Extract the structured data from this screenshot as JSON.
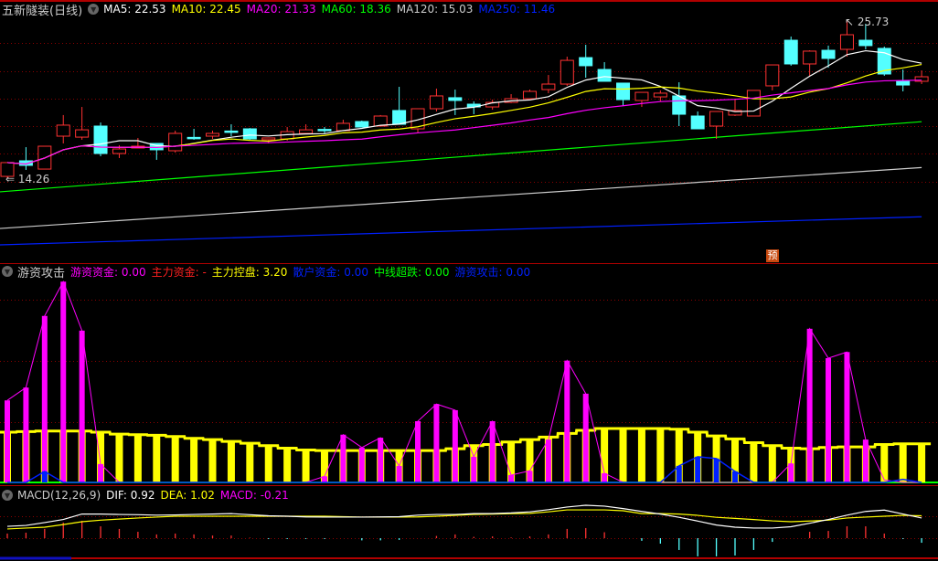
{
  "main_panel": {
    "title": "五新隧装(日线)",
    "ma_legend": [
      {
        "label": "MA5: 22.53",
        "color": "#ffffff"
      },
      {
        "label": "MA10: 22.45",
        "color": "#ffff00"
      },
      {
        "label": "MA20: 21.33",
        "color": "#ff00ff"
      },
      {
        "label": "MA60: 18.36",
        "color": "#00ff00"
      },
      {
        "label": "MA120: 15.03",
        "color": "#cccccc"
      },
      {
        "label": "MA250: 11.46",
        "color": "#0020ff"
      }
    ],
    "high_label": "25.73",
    "low_label": "14.26",
    "forecast_badge": "预"
  },
  "indicator_panel": {
    "title": "游资攻击",
    "legend": [
      {
        "label": "游资资金: 0.00",
        "color": "#ff00ff"
      },
      {
        "label": "主力资金: -",
        "color": "#ff2020"
      },
      {
        "label": "主力控盘: 3.20",
        "color": "#ffff00"
      },
      {
        "label": "散户资金: 0.00",
        "color": "#0020ff"
      },
      {
        "label": "中线超跌: 0.00",
        "color": "#00ff00"
      },
      {
        "label": "游资攻击: 0.00",
        "color": "#0020ff"
      }
    ]
  },
  "macd_panel": {
    "title": "MACD(12,26,9)",
    "legend": [
      {
        "label": "DIF: 0.92",
        "color": "#ffffff"
      },
      {
        "label": "DEA: 1.02",
        "color": "#ffff00"
      },
      {
        "label": "MACD: -0.21",
        "color": "#ff00ff"
      }
    ]
  },
  "colors": {
    "up": "#ff3232",
    "down": "#54ffff",
    "grid": "#8b0000",
    "separator": "#b00000"
  },
  "chart_data": [
    {
      "type": "candlestick",
      "title": "五新隧装(日线)",
      "price_range": [
        8.29,
        27.19
      ],
      "candles": [
        [
          14.39,
          15.39,
          14.26,
          15.39
        ],
        [
          15.52,
          16.51,
          14.86,
          15.19
        ],
        [
          14.92,
          16.58,
          14.92,
          16.58
        ],
        [
          17.31,
          18.84,
          16.78,
          18.11
        ],
        [
          17.24,
          19.43,
          17.05,
          17.77
        ],
        [
          18.04,
          18.3,
          15.85,
          16.05
        ],
        [
          16.05,
          16.65,
          15.72,
          16.38
        ],
        [
          16.45,
          17.18,
          16.45,
          16.58
        ],
        [
          16.78,
          16.78,
          15.59,
          16.32
        ],
        [
          16.25,
          17.71,
          16.12,
          17.51
        ],
        [
          17.22,
          17.84,
          17.05,
          17.18
        ],
        [
          17.31,
          17.71,
          17.11,
          17.51
        ],
        [
          17.68,
          18.17,
          17.31,
          17.64
        ],
        [
          17.84,
          17.9,
          17.05,
          17.11
        ],
        [
          17.05,
          17.18,
          16.78,
          17.18
        ],
        [
          17.11,
          17.97,
          16.98,
          17.64
        ],
        [
          17.51,
          18.17,
          17.51,
          17.77
        ],
        [
          17.8,
          17.97,
          17.51,
          17.75
        ],
        [
          17.71,
          18.5,
          17.71,
          18.24
        ],
        [
          18.37,
          18.44,
          17.97,
          17.97
        ],
        [
          18.04,
          18.84,
          18.04,
          18.77
        ],
        [
          19.17,
          20.89,
          18.17,
          18.17
        ],
        [
          17.84,
          19.3,
          17.58,
          19.3
        ],
        [
          19.3,
          20.76,
          19.1,
          20.23
        ],
        [
          20.1,
          20.69,
          18.84,
          19.9
        ],
        [
          19.63,
          19.83,
          18.9,
          19.43
        ],
        [
          19.43,
          19.96,
          19.23,
          19.76
        ],
        [
          19.76,
          20.36,
          19.7,
          20.03
        ],
        [
          20.03,
          20.69,
          20.03,
          20.56
        ],
        [
          20.69,
          21.75,
          20.43,
          21.09
        ],
        [
          21.09,
          23.08,
          20.96,
          22.81
        ],
        [
          23.01,
          23.94,
          21.55,
          22.42
        ],
        [
          22.15,
          22.68,
          21.29,
          21.29
        ],
        [
          21.16,
          21.16,
          19.5,
          19.96
        ],
        [
          19.9,
          20.49,
          19.43,
          20.49
        ],
        [
          20.16,
          20.63,
          19.83,
          20.43
        ],
        [
          20.23,
          21.22,
          18.04,
          18.9
        ],
        [
          18.77,
          19.1,
          17.84,
          17.84
        ],
        [
          18.04,
          19.1,
          17.11,
          19.1
        ],
        [
          18.84,
          20.03,
          18.77,
          19.17
        ],
        [
          18.77,
          20.63,
          18.77,
          20.63
        ],
        [
          20.96,
          22.48,
          20.63,
          22.48
        ],
        [
          24.27,
          24.54,
          22.42,
          22.55
        ],
        [
          22.55,
          23.54,
          21.69,
          23.48
        ],
        [
          23.54,
          23.88,
          22.28,
          22.95
        ],
        [
          23.61,
          25.73,
          23.08,
          24.67
        ],
        [
          24.27,
          25.47,
          23.61,
          23.88
        ],
        [
          23.68,
          23.81,
          21.69,
          21.82
        ],
        [
          21.29,
          22.15,
          20.56,
          21.02
        ],
        [
          21.29,
          22.08,
          21.09,
          21.62
        ]
      ],
      "candle_fields": [
        "open",
        "high",
        "low",
        "close"
      ],
      "long_ma": {
        "ma60": [
          13.27,
          18.36
        ],
        "ma120": [
          10.61,
          15.03
        ],
        "ma250": [
          9.42,
          11.46
        ]
      }
    },
    {
      "type": "bar",
      "title": "游资攻击",
      "ylim": [
        0,
        3.55
      ],
      "magenta": [
        1.34,
        1.55,
        2.72,
        3.28,
        2.48,
        0.3,
        0,
        0,
        0,
        0,
        0,
        0,
        0,
        0,
        0,
        0,
        0,
        0.1,
        0.78,
        0.57,
        0.73,
        0.27,
        1.0,
        1.28,
        1.18,
        0.42,
        1.0,
        0.12,
        0.19,
        0.7,
        1.99,
        1.45,
        0.15,
        0,
        0,
        0,
        0,
        0,
        0,
        0,
        0,
        0,
        0.31,
        2.51,
        2.03,
        2.13,
        0.7,
        0.04,
        0,
        0
      ],
      "yellow": [
        0.82,
        0.83,
        0.84,
        0.84,
        0.84,
        0.82,
        0.79,
        0.78,
        0.77,
        0.75,
        0.72,
        0.7,
        0.67,
        0.64,
        0.6,
        0.56,
        0.53,
        0.52,
        0.52,
        0.52,
        0.52,
        0.52,
        0.52,
        0.52,
        0.55,
        0.6,
        0.62,
        0.66,
        0.7,
        0.74,
        0.8,
        0.85,
        0.88,
        0.88,
        0.88,
        0.88,
        0.87,
        0.82,
        0.76,
        0.71,
        0.65,
        0.6,
        0.56,
        0.55,
        0.57,
        0.58,
        0.58,
        0.62,
        0.63,
        0.63
      ],
      "blue": [
        0,
        0,
        0.18,
        0,
        0,
        0,
        0,
        0,
        0,
        0,
        0,
        0,
        0,
        0,
        0,
        0,
        0,
        0,
        0,
        0,
        0,
        0,
        0,
        0,
        0,
        0,
        0,
        0,
        0,
        0,
        0,
        0,
        0,
        0,
        0,
        0,
        0.27,
        0.42,
        0.39,
        0.18,
        0,
        0,
        0,
        0,
        0,
        0,
        0,
        0,
        0.05,
        0
      ]
    },
    {
      "type": "line",
      "title": "MACD(12,26,9)",
      "ylim": [
        -1.05,
        2.3
      ],
      "dif": [
        0.54,
        0.58,
        0.71,
        0.85,
        1.1,
        1.1,
        1.08,
        1.07,
        1.05,
        1.06,
        1.08,
        1.1,
        1.12,
        1.07,
        1.02,
        1.0,
        0.97,
        0.96,
        0.96,
        0.96,
        0.97,
        0.98,
        1.05,
        1.08,
        1.08,
        1.12,
        1.12,
        1.15,
        1.2,
        1.3,
        1.42,
        1.5,
        1.46,
        1.35,
        1.22,
        1.1,
        0.95,
        0.78,
        0.6,
        0.5,
        0.46,
        0.46,
        0.52,
        0.68,
        0.85,
        1.05,
        1.22,
        1.28,
        1.1,
        0.92
      ],
      "dea": [
        0.42,
        0.46,
        0.5,
        0.62,
        0.75,
        0.82,
        0.87,
        0.92,
        0.96,
        1.0,
        1.0,
        1.0,
        1.0,
        1.0,
        1.0,
        1.0,
        1.0,
        1.0,
        0.98,
        0.96,
        0.96,
        0.96,
        0.97,
        1.0,
        1.04,
        1.08,
        1.1,
        1.12,
        1.13,
        1.2,
        1.29,
        1.29,
        1.29,
        1.25,
        1.12,
        1.12,
        1.1,
        1.04,
        0.95,
        0.9,
        0.85,
        0.79,
        0.75,
        0.78,
        0.82,
        0.92,
        0.96,
        1.0,
        1.04,
        1.02
      ],
      "macd": [
        0.21,
        0.25,
        0.42,
        0.71,
        0.79,
        0.54,
        0.42,
        0.29,
        0.17,
        0.21,
        0.17,
        0.12,
        0.12,
        0.02,
        -0.04,
        -0.04,
        -0.04,
        -0.04,
        0.0,
        -0.1,
        -0.1,
        -0.08,
        0.0,
        0.1,
        0.17,
        0.06,
        0.08,
        0.03,
        0.08,
        0.17,
        0.42,
        0.46,
        0.27,
        0.0,
        -0.12,
        -0.25,
        -0.54,
        -0.83,
        -0.83,
        -0.79,
        -0.54,
        -0.17,
        0.0,
        0.29,
        0.33,
        0.54,
        0.54,
        0.21,
        -0.04,
        -0.21
      ]
    }
  ]
}
